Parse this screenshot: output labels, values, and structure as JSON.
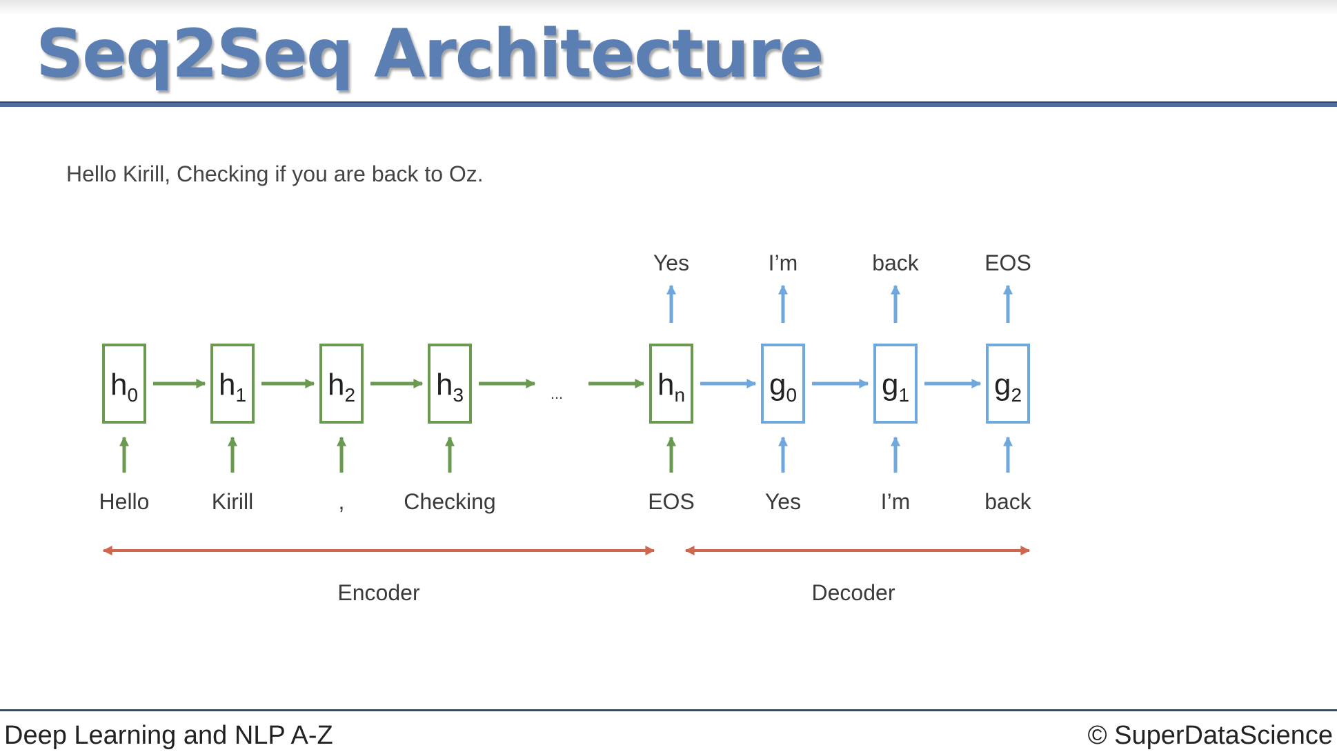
{
  "title": "Seq2Seq Architecture",
  "example_sentence": "Hello Kirill, Checking if you are back to Oz.",
  "diagram": {
    "colors": {
      "encoder": "#6a9a4f",
      "decoder": "#6fa8dc",
      "span": "#d0674d",
      "text": "#3a3a3a"
    },
    "encoder_cells": [
      {
        "base": "h",
        "sub": "0",
        "input": "Hello"
      },
      {
        "base": "h",
        "sub": "1",
        "input": "Kirill"
      },
      {
        "base": "h",
        "sub": "2",
        "input": ","
      },
      {
        "base": "h",
        "sub": "3",
        "input": "Checking"
      }
    ],
    "ellipsis": "...",
    "final_encoder_cell": {
      "base": "h",
      "sub": "n",
      "input": "EOS",
      "output": "Yes"
    },
    "decoder_cells": [
      {
        "base": "g",
        "sub": "0",
        "input": "Yes",
        "output": "I’m"
      },
      {
        "base": "g",
        "sub": "1",
        "input": "I’m",
        "output": "back"
      },
      {
        "base": "g",
        "sub": "2",
        "input": "back",
        "output": "EOS"
      }
    ],
    "encoder_label": "Encoder",
    "decoder_label": "Decoder"
  },
  "footer": {
    "course": "Deep Learning and NLP A-Z",
    "copyright": "© SuperDataScience"
  }
}
